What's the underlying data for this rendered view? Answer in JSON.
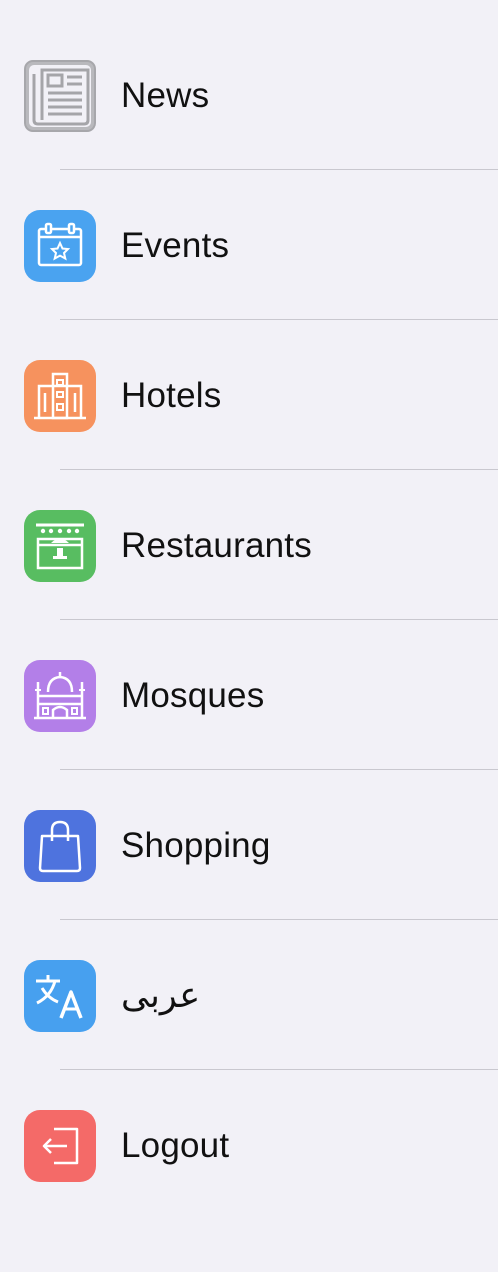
{
  "menu": {
    "items": [
      {
        "label": "News",
        "icon": "newspaper-icon",
        "color": "#b5b5b8"
      },
      {
        "label": "Events",
        "icon": "calendar-star-icon",
        "color": "#4aa3f0"
      },
      {
        "label": "Hotels",
        "icon": "hotel-building-icon",
        "color": "#f6925e"
      },
      {
        "label": "Restaurants",
        "icon": "restaurant-counter-icon",
        "color": "#58bd61"
      },
      {
        "label": "Mosques",
        "icon": "mosque-icon",
        "color": "#b37fe8"
      },
      {
        "label": "Shopping",
        "icon": "shopping-bag-icon",
        "color": "#4e73de"
      },
      {
        "label": "عربى",
        "icon": "translate-icon",
        "color": "#47a0ef"
      },
      {
        "label": "Logout",
        "icon": "logout-icon",
        "color": "#f46a68"
      }
    ]
  }
}
